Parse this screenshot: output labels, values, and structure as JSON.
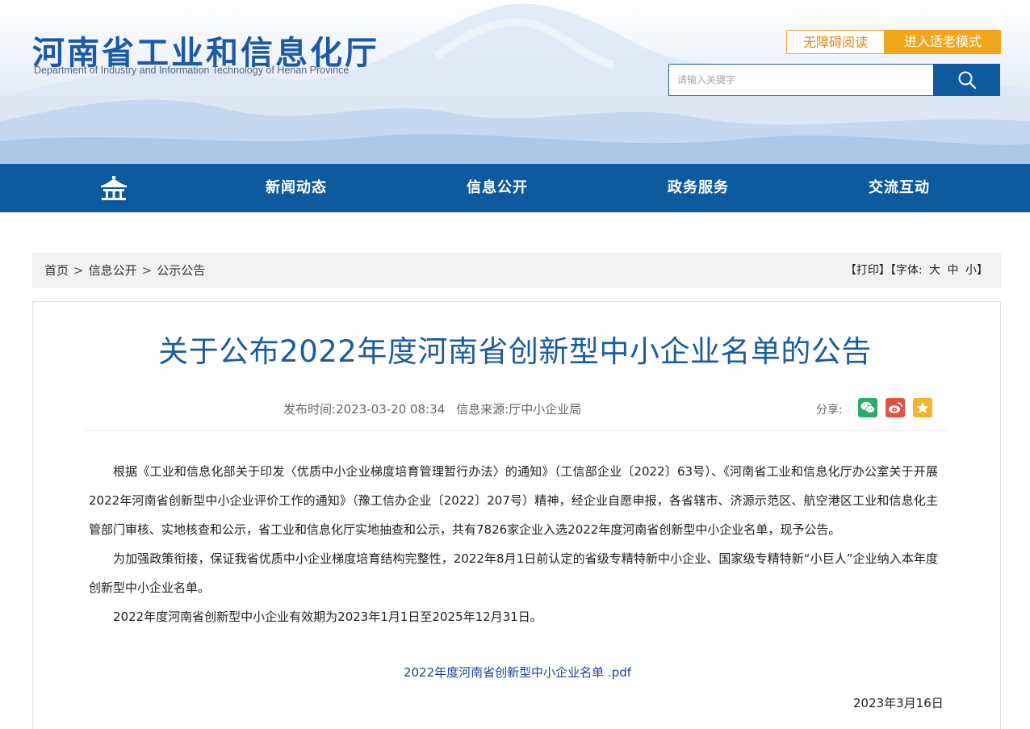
{
  "header": {
    "site_title": "河南省工业和信息化厅",
    "site_subtitle": "Department of Industry and Information Technology of Henan Province",
    "accessible_label": "无障碍阅读",
    "elder_mode_label": "进入适老模式",
    "search_placeholder": "请输入关键字",
    "search_icon": "search-icon"
  },
  "nav": {
    "home_icon": "pavilion-home-icon",
    "items": [
      "新闻动态",
      "信息公开",
      "政务服务",
      "交流互动"
    ]
  },
  "breadcrumb": {
    "items": [
      "首页",
      "信息公开",
      "公示公告"
    ],
    "separator": ">"
  },
  "tools": {
    "print": "【打印】",
    "font_prefix": "【字体:",
    "font_large": "大",
    "font_medium": "中",
    "font_small": "小",
    "font_suffix": "】"
  },
  "article": {
    "title": "关于公布2022年度河南省创新型中小企业名单的公告",
    "publish_time_label": "发布时间:",
    "publish_time": "2023-03-20 08:34",
    "source_label": "信息来源:",
    "source": "厅中小企业局",
    "share_label": "分享:",
    "paragraphs": [
      "根据《工业和信息化部关于印发〈优质中小企业梯度培育管理暂行办法〉的通知》（工信部企业〔2022〕63号）、《河南省工业和信息化厅办公室关于开展2022年河南省创新型中小企业评价工作的通知》（豫工信办企业〔2022〕207号）精神，经企业自愿申报，各省辖市、济源示范区、航空港区工业和信息化主管部门审核、实地核查和公示，省工业和信息化厅实地抽查和公示，共有7826家企业入选2022年度河南省创新型中小企业名单，现予公告。",
      "为加强政策衔接，保证我省优质中小企业梯度培育结构完整性，2022年8月1日前认定的省级专精特新中小企业、国家级专精特新“小巨人”企业纳入本年度创新型中小企业名单。",
      "2022年度河南省创新型中小企业有效期为2023年1月1日至2025年12月31日。"
    ],
    "attachment": "2022年度河南省创新型中小企业名单 .pdf",
    "date": "2023年3月16日"
  },
  "colors": {
    "brand_blue": "#0e5a9e",
    "title_blue": "#1b5c9e",
    "accent_orange": "#f3a51c",
    "wechat_green": "#2aae67",
    "weibo_red": "#e05244",
    "favorite_yellow": "#f3b52d"
  }
}
